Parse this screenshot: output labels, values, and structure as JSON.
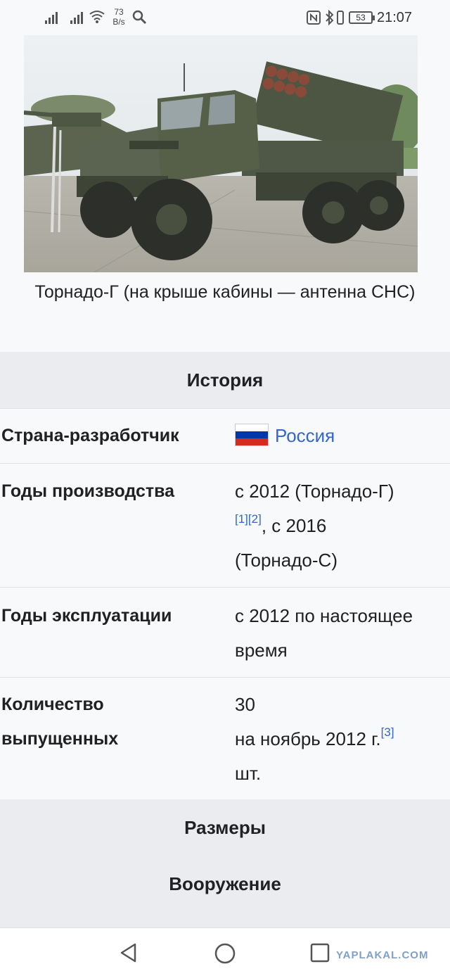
{
  "status_bar": {
    "net_speed_value": "73",
    "net_speed_unit": "B/s",
    "battery": "53",
    "time": "21:07"
  },
  "figure": {
    "caption": "Торнадо-Г (на крыше кабины — антенна СНС)"
  },
  "sections": {
    "history": "История",
    "dimensions": "Размеры",
    "armament": "Вооружение"
  },
  "rows": {
    "country": {
      "label": "Страна-разработчик",
      "value": "Россия"
    },
    "production": {
      "label": "Годы производства",
      "value_a": "с 2012 (Торнадо-Г)",
      "ref1": "[1]",
      "ref2": "[2]",
      "value_b": ", с 2016 (Торнадо-С)"
    },
    "service": {
      "label": "Годы эксплуатации",
      "value": "с 2012 по настоящее время"
    },
    "quantity": {
      "label": "Количество выпущенных",
      "value_a": "30",
      "value_b": "на ноябрь 2012 г.",
      "ref3": "[3]",
      "value_c": " шт."
    }
  },
  "nav": {
    "watermark": "YAPLAKAL.COM"
  }
}
